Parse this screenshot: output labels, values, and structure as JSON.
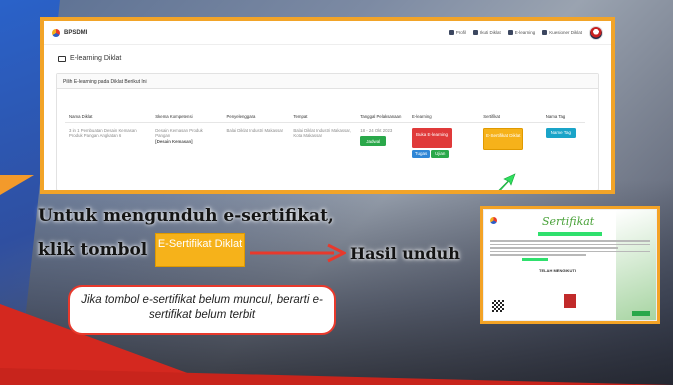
{
  "app": {
    "brand": "BPSDMI",
    "nav": [
      "Profil",
      "Ikuti Diklat",
      "E-learning",
      "Kuesioner Diklat"
    ]
  },
  "page": {
    "title": "E-learning Diklat",
    "card_title": "Pilih E-learning pada Diklat Berikut Ini"
  },
  "table": {
    "headers": [
      "Nama Diklat",
      "Skema Kompetensi",
      "Penyelenggara",
      "Tempat",
      "Tanggal Pelaksanaan",
      "E-learning",
      "Sertifikat",
      "Nama Tag"
    ],
    "row": {
      "nama": "3 in 1 Pembuatan Desain Kemasan Produk Pangan Angkatan 6",
      "skema": "Desain Kemasan Produk Pangan",
      "skema_bold": "[Desain Kemasan]",
      "penyelenggara": "Balai Diklat Industri Makassar",
      "tempat": "Balai Diklat Industri Makassar, Kota Makassar",
      "tanggal": "18 - 24 Okt 2023",
      "btn_jadwal": "Jadwal",
      "btn_buka": "Buka E-learning",
      "btn_tugas": "Tugas",
      "btn_ujian": "Ujian",
      "btn_sertifikat": "E-Sertifikat Diklat",
      "btn_tag": "Name Tag"
    }
  },
  "overlay": {
    "line1": "Untuk mengunduh e-sertifikat,",
    "line2": "klik tombol",
    "cta": "E-Sertifikat Diklat",
    "result": "Hasil unduh",
    "note": "Jika tombol e-sertifikat belum muncul, berarti e-sertifikat belum terbit"
  },
  "certificate": {
    "title": "Sertifikat",
    "name": "TELAH MENGIKUTI"
  }
}
